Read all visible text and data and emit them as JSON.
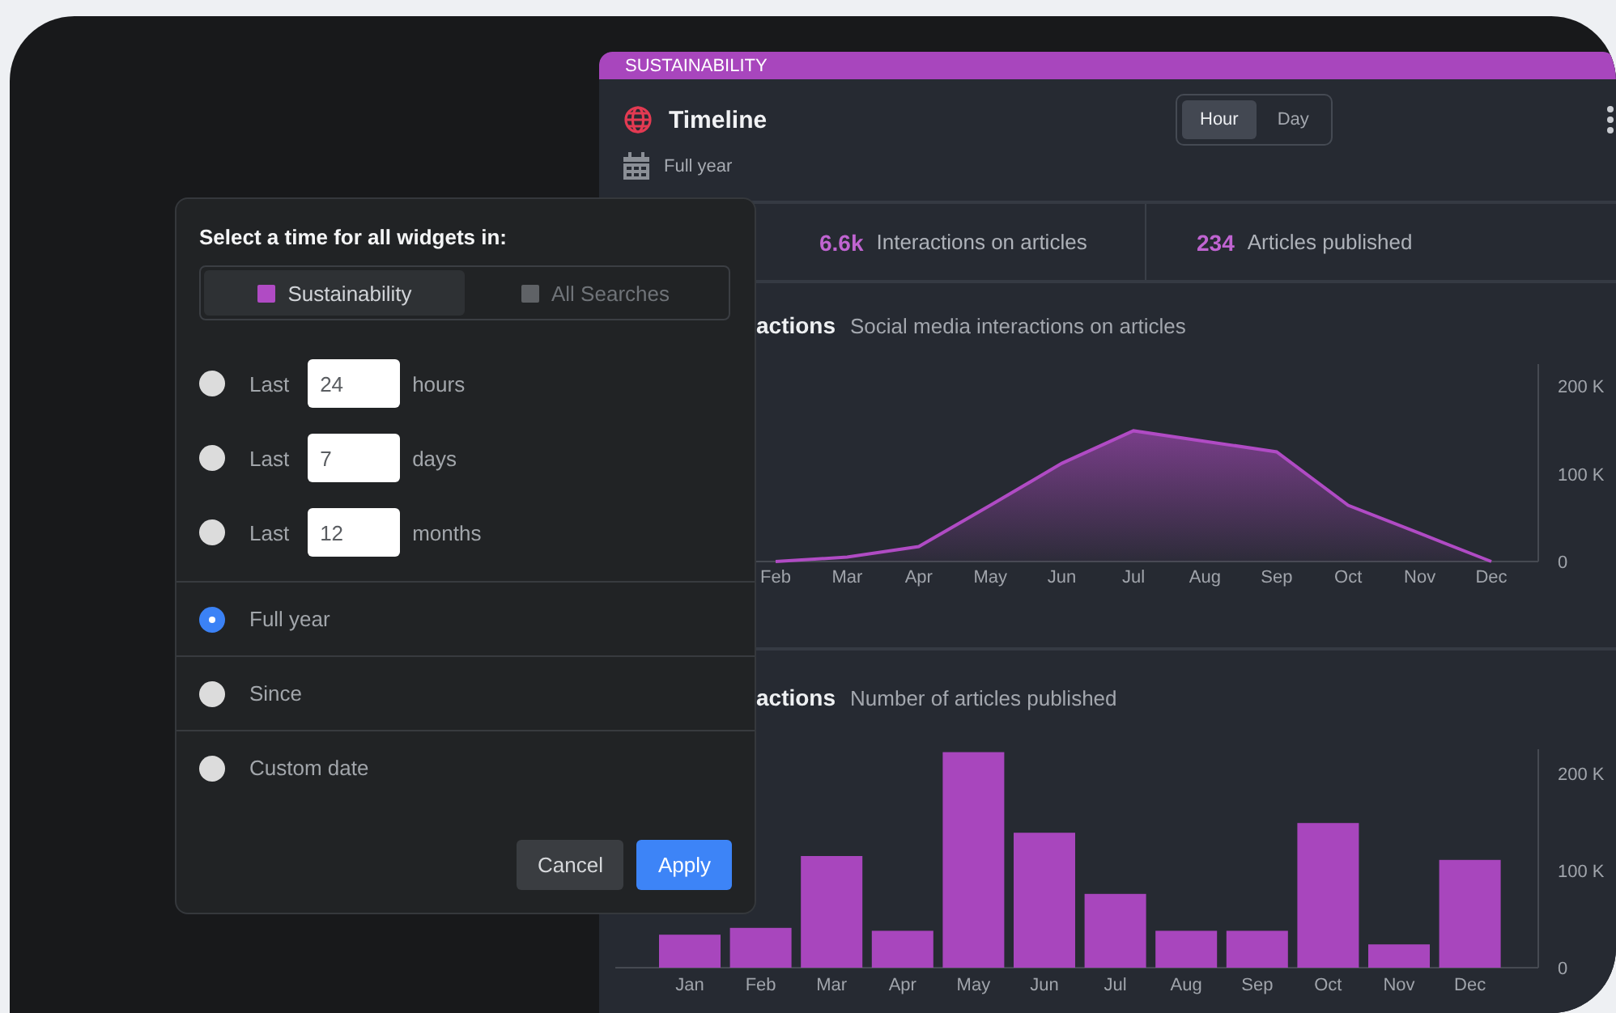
{
  "dashboard": {
    "search_tag": "SUSTAINABILITY",
    "title": "Timeline",
    "granularity": [
      {
        "label": "Hour",
        "selected": true
      },
      {
        "label": "Day",
        "selected": false
      }
    ],
    "period": "Full year",
    "stats": [
      {
        "value": "6.6k",
        "label": "Interactions on articles"
      },
      {
        "value": "234",
        "label": "Articles published"
      }
    ],
    "widgets": [
      {
        "title": "actions",
        "subtitle": "Social media interactions on articles",
        "chart_data": {
          "type": "area",
          "categories": [
            "Feb",
            "Mar",
            "Apr",
            "May",
            "Jun",
            "Jul",
            "Aug",
            "Sep",
            "Oct",
            "Nov",
            "Dec"
          ],
          "series": [
            {
              "color": "#b04bc4",
              "values": [
                0,
                5000,
                17000,
                64000,
                112000,
                149000,
                137000,
                125000,
                64000,
                32000,
                0
              ]
            }
          ],
          "ylim": [
            0,
            225000
          ],
          "yticks": [
            {
              "value": 0,
              "label": "0"
            },
            {
              "value": 100000,
              "label": "100 K"
            },
            {
              "value": 200000,
              "label": "200 K"
            }
          ]
        }
      },
      {
        "title": "actions",
        "subtitle": "Number of articles published",
        "chart_data": {
          "type": "bar",
          "categories": [
            "Jan",
            "Feb",
            "Mar",
            "Apr",
            "May",
            "Jun",
            "Jul",
            "Aug",
            "Sep",
            "Oct",
            "Nov",
            "Dec"
          ],
          "series": [
            {
              "color": "#a846bd",
              "values": [
                34000,
                41000,
                115000,
                38000,
                222000,
                139000,
                76000,
                38000,
                38000,
                149000,
                24000,
                111000
              ]
            }
          ],
          "ylim": [
            0,
            225000
          ],
          "yticks": [
            {
              "value": 0,
              "label": "0"
            },
            {
              "value": 100000,
              "label": "100 K"
            },
            {
              "value": 200000,
              "label": "200 K"
            }
          ]
        }
      }
    ]
  },
  "time_dialog": {
    "title": "Select a time for all widgets in:",
    "scopes": [
      {
        "label": "Sustainability",
        "selected": true
      },
      {
        "label": "All Searches",
        "selected": false
      }
    ],
    "options": [
      {
        "kind": "last",
        "selected": false,
        "prefix": "Last",
        "value": "24",
        "unit": "hours"
      },
      {
        "kind": "last",
        "selected": false,
        "prefix": "Last",
        "value": "7",
        "unit": "days"
      },
      {
        "kind": "last",
        "selected": false,
        "prefix": "Last",
        "value": "12",
        "unit": "months"
      },
      {
        "kind": "plain",
        "selected": true,
        "label": "Full year"
      },
      {
        "kind": "plain",
        "selected": false,
        "label": "Since"
      },
      {
        "kind": "plain",
        "selected": false,
        "label": "Custom date"
      }
    ],
    "buttons": [
      {
        "label": "Cancel",
        "kind": "secondary"
      },
      {
        "label": "Apply",
        "kind": "primary"
      }
    ]
  }
}
